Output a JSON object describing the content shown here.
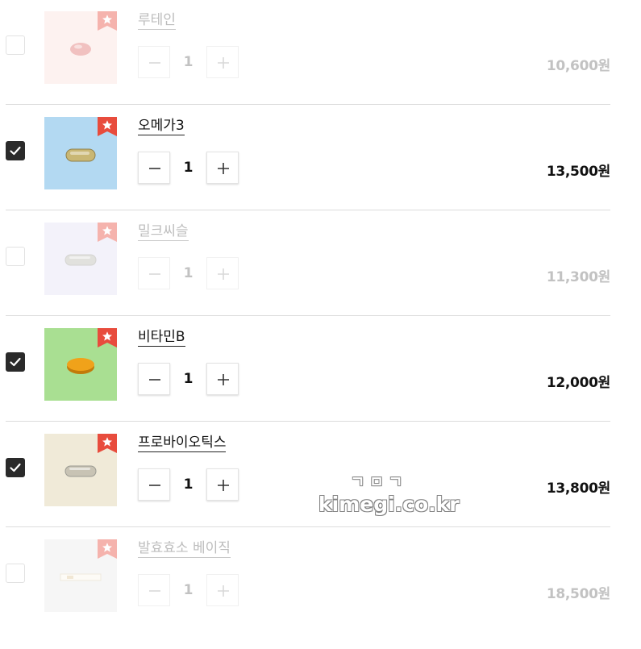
{
  "cart": {
    "items": [
      {
        "name": "루테인",
        "qty": "1",
        "price": "10,600원",
        "checked": false,
        "bg": "#fbe2dc",
        "pill_color": "#e06d6a",
        "pill_shape": "oval"
      },
      {
        "name": "오메가3",
        "qty": "1",
        "price": "13,500원",
        "checked": true,
        "bg": "#b3d9f2",
        "pill_color": "#c9b774",
        "pill_shape": "softgel"
      },
      {
        "name": "밀크씨슬",
        "qty": "1",
        "price": "11,300원",
        "checked": false,
        "bg": "#e4e1f5",
        "pill_color": "#b8b8b0",
        "pill_shape": "capsule"
      },
      {
        "name": "비타민B",
        "qty": "1",
        "price": "12,000원",
        "checked": true,
        "bg": "#a9df92",
        "pill_color": "#f0a21a",
        "pill_shape": "tablet"
      },
      {
        "name": "프로바이오틱스",
        "qty": "1",
        "price": "13,800원",
        "checked": true,
        "bg": "#f0ead8",
        "pill_color": "#c8c3b4",
        "pill_shape": "capsule"
      },
      {
        "name": "발효효소 베이직",
        "qty": "1",
        "price": "18,500원",
        "checked": false,
        "bg": "#ececec",
        "pill_color": "#e8dfc9",
        "pill_shape": "stick"
      }
    ]
  },
  "icons": {
    "checkbox": "check-icon",
    "minus": "minus-icon",
    "plus": "plus-icon",
    "badge": "star-icon"
  },
  "colors": {
    "badge_red": "#e84c3d",
    "checked_box": "#2a2a2a"
  },
  "watermark": {
    "korean": "ㄱㅁㄱ",
    "site": "kimegi.co.kr"
  }
}
